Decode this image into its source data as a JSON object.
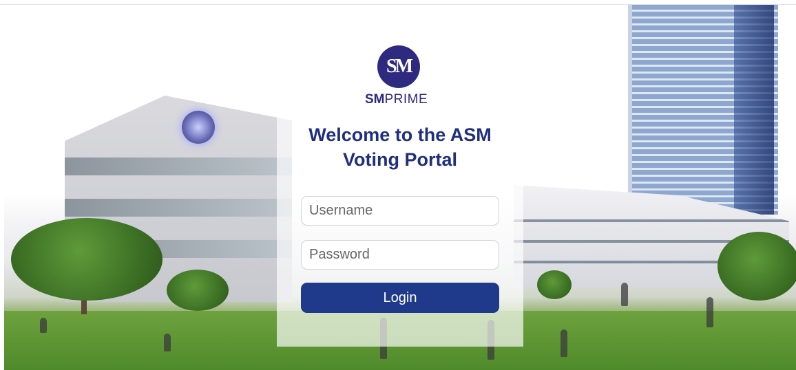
{
  "brand": {
    "bold": "SM",
    "regular": "PRIME",
    "logo_mark": "SM",
    "color": "#2e2a7f"
  },
  "welcome": {
    "line1": "Welcome to the ASM",
    "line2": "Voting Portal"
  },
  "form": {
    "username_placeholder": "Username",
    "username_value": "",
    "password_placeholder": "Password",
    "password_value": "",
    "login_label": "Login"
  },
  "colors": {
    "title": "#1f2f80",
    "button": "#1f3a8a",
    "button_text": "#ffffff"
  },
  "background": {
    "description_icon": "mall-campus-photo"
  }
}
